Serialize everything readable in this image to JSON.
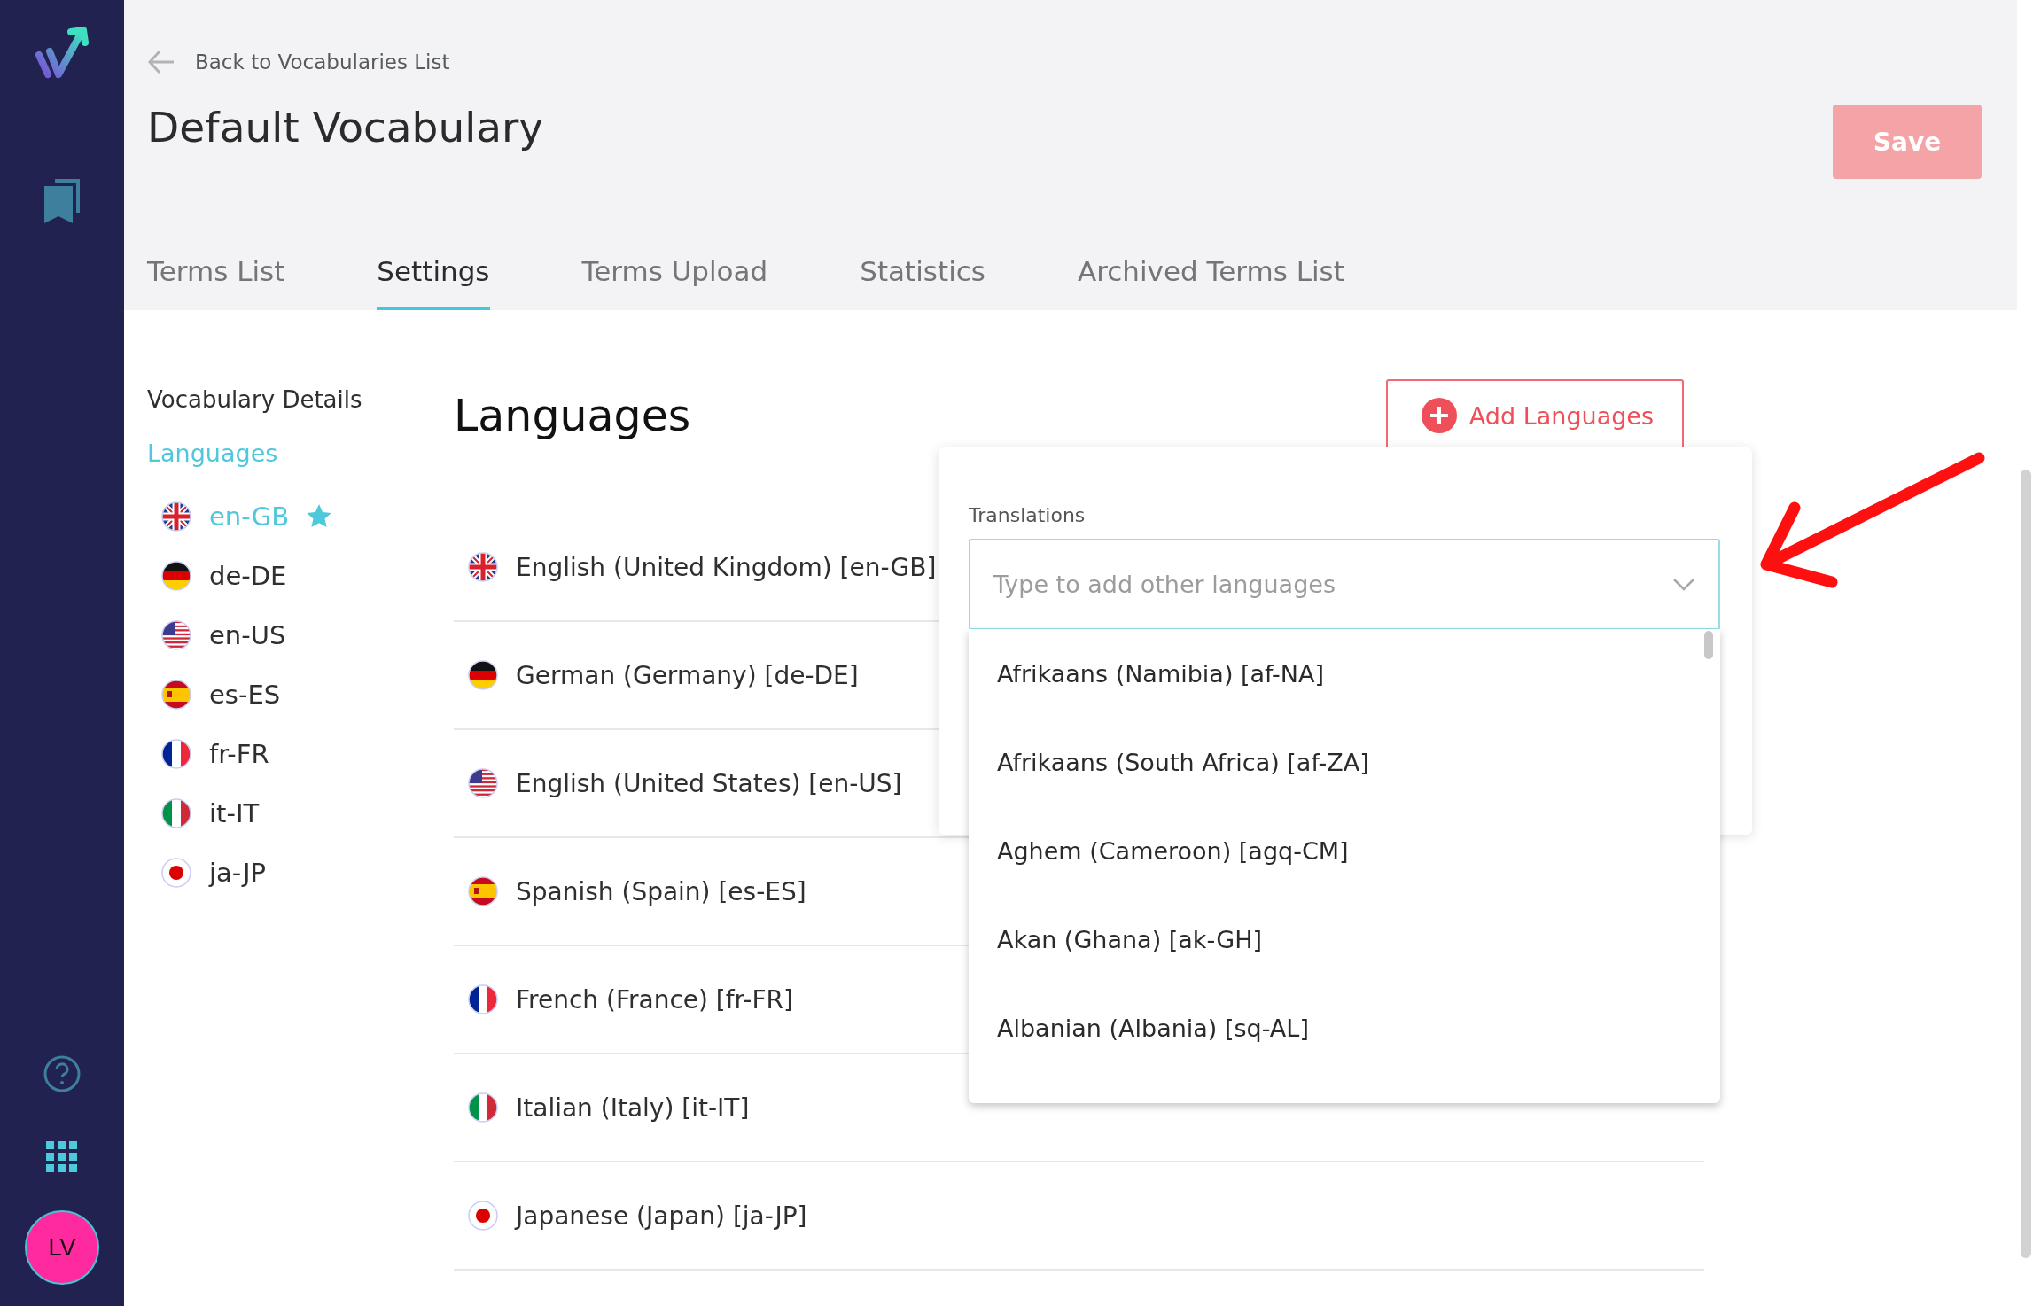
{
  "app_bar": {
    "avatar": "LV"
  },
  "back_link": "Back to Vocabularies List",
  "title": "Default Vocabulary",
  "save_button": {
    "label": "Save",
    "disabled": true
  },
  "tabs": [
    {
      "label": "Terms List",
      "selected": false
    },
    {
      "label": "Settings",
      "selected": true
    },
    {
      "label": "Terms Upload",
      "selected": false
    },
    {
      "label": "Statistics",
      "selected": false
    },
    {
      "label": "Archived Terms List",
      "selected": false
    }
  ],
  "side_nav": {
    "heading": "Vocabulary Details",
    "section": "Languages",
    "items": [
      {
        "code": "en-GB",
        "kind": "gb",
        "selected": true,
        "default": true
      },
      {
        "code": "de-DE",
        "kind": "de",
        "selected": false,
        "default": false
      },
      {
        "code": "en-US",
        "kind": "us",
        "selected": false,
        "default": false
      },
      {
        "code": "es-ES",
        "kind": "es",
        "selected": false,
        "default": false
      },
      {
        "code": "fr-FR",
        "kind": "fr",
        "selected": false,
        "default": false
      },
      {
        "code": "it-IT",
        "kind": "it",
        "selected": false,
        "default": false
      },
      {
        "code": "ja-JP",
        "kind": "jp",
        "selected": false,
        "default": false
      }
    ]
  },
  "languages": {
    "heading": "Languages",
    "add_button": "Add Languages",
    "rows": [
      {
        "label": "English (United Kingdom) [en-GB]",
        "kind": "gb"
      },
      {
        "label": "German (Germany) [de-DE]",
        "kind": "de"
      },
      {
        "label": "English (United States) [en-US]",
        "kind": "us"
      },
      {
        "label": "Spanish (Spain) [es-ES]",
        "kind": "es"
      },
      {
        "label": "French (France) [fr-FR]",
        "kind": "fr"
      },
      {
        "label": "Italian (Italy) [it-IT]",
        "kind": "it"
      },
      {
        "label": "Japanese (Japan) [ja-JP]",
        "kind": "jp"
      }
    ]
  },
  "popover": {
    "label": "Translations",
    "placeholder": "Type to add other languages",
    "options": [
      "Afrikaans (Namibia) [af-NA]",
      "Afrikaans (South Africa) [af-ZA]",
      "Aghem (Cameroon) [agq-CM]",
      "Akan (Ghana) [ak-GH]",
      "Albanian (Albania) [sq-AL]"
    ]
  }
}
